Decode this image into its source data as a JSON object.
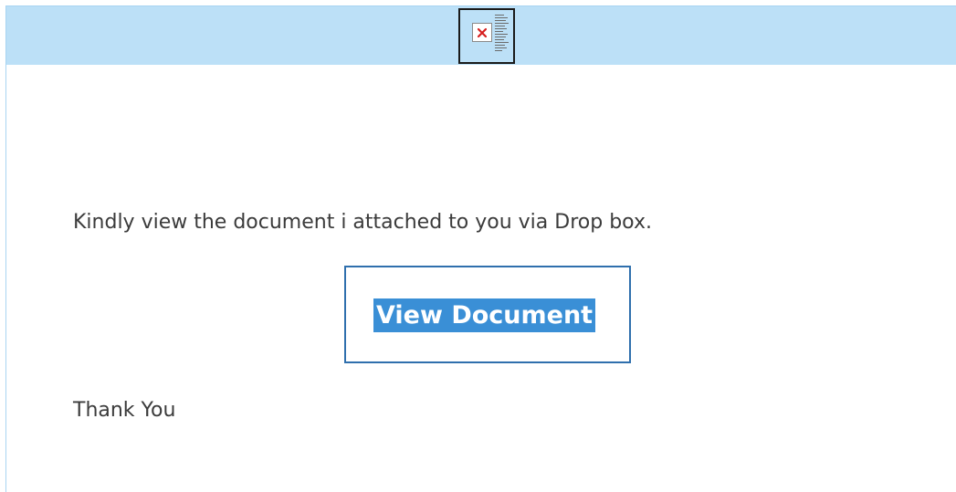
{
  "header": {
    "logo_icon": "broken-image-icon",
    "background_color": "#bce0f7"
  },
  "body": {
    "message": "Kindly view the document i attached to you via Drop box.",
    "cta_label": "View Document",
    "closing": "Thank You"
  },
  "colors": {
    "frame_border": "#a9d4f2",
    "cta_border": "#2f6fad",
    "cta_background": "#3a8fd6",
    "text": "#3b3b3b"
  }
}
